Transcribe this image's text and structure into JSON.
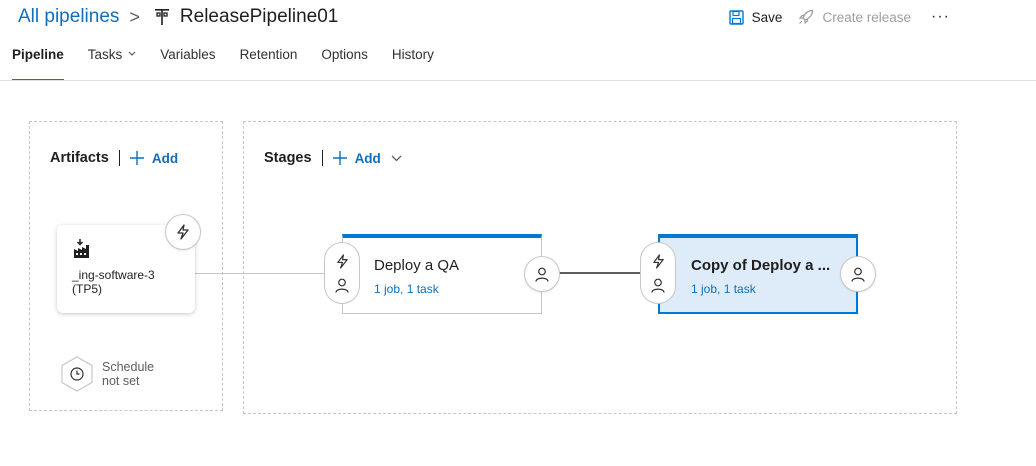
{
  "header": {
    "breadcrumb_root": "All pipelines",
    "breadcrumb_separator": ">",
    "pipeline_name": "ReleasePipeline01",
    "save_label": "Save",
    "create_release_label": "Create release",
    "more_label": "···"
  },
  "tabs": [
    {
      "label": "Pipeline",
      "active": true
    },
    {
      "label": "Tasks",
      "active": false
    },
    {
      "label": "Variables",
      "active": false
    },
    {
      "label": "Retention",
      "active": false
    },
    {
      "label": "Options",
      "active": false
    },
    {
      "label": "History",
      "active": false
    }
  ],
  "artifacts": {
    "title": "Artifacts",
    "add_label": "Add",
    "card_name": "_ing-software-3 (TP5)",
    "schedule_label": "Schedule not set"
  },
  "stages": {
    "title": "Stages",
    "add_label": "Add",
    "items": [
      {
        "name": "Deploy a QA",
        "meta": "1 job, 1 task",
        "selected": false
      },
      {
        "name": "Copy of Deploy a ...",
        "meta": "1 job, 1 task",
        "selected": true
      }
    ]
  },
  "colors": {
    "accent": "#0078d4",
    "link": "#106ebe",
    "selected_bg": "#deecf9",
    "disabled": "#a19f9d"
  },
  "icons": [
    "pipeline-icon",
    "save-icon",
    "rocket-icon",
    "plus-icon",
    "chevron-down-icon",
    "lightning-icon",
    "person-icon",
    "clock-icon",
    "build-artifact-icon"
  ]
}
